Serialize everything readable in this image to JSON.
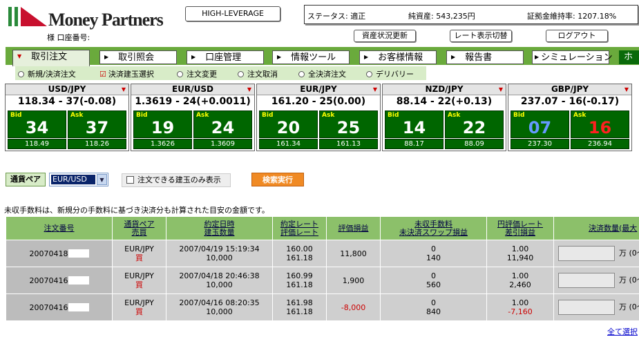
{
  "brand": {
    "name": "Money Partners",
    "account_label": "様 口座番号:"
  },
  "header": {
    "leverage_button": "HIGH-LEVERAGE",
    "status": "ステータス: 適正",
    "net_assets": "純資産: 543,235円",
    "margin_rate": "証拠金維持率: 1207.18%",
    "asset_update": "資産状況更新",
    "rate_toggle": "レート表示切替",
    "logout": "ログアウト"
  },
  "nav": {
    "tabs": [
      "取引注文",
      "取引照会",
      "口座管理",
      "情報ツール",
      "お客様情報",
      "報告書",
      "シミュレーション",
      "ホ"
    ],
    "active": 0
  },
  "subnav": [
    "新規/決済注文",
    "決済建玉選択",
    "注文変更",
    "注文取消",
    "全決済注文",
    "デリバリー"
  ],
  "rates": [
    {
      "pair": "USD/JPY",
      "line": "118.34 - 37(-0.08)",
      "bid_label": "Bid",
      "bid": "34",
      "ask_label": "Ask",
      "ask": "37",
      "low": "118.49",
      "high": "118.26"
    },
    {
      "pair": "EUR/USD",
      "line": "1.3619 - 24(+0.0011)",
      "bid_label": "Bid",
      "bid": "19",
      "ask_label": "Ask",
      "ask": "24",
      "low": "1.3626",
      "high": "1.3609"
    },
    {
      "pair": "EUR/JPY",
      "line": "161.20 - 25(0.00)",
      "bid_label": "Bid",
      "bid": "20",
      "ask_label": "Ask",
      "ask": "25",
      "low": "161.34",
      "high": "161.13"
    },
    {
      "pair": "NZD/JPY",
      "line": "88.14 - 22(+0.13)",
      "bid_label": "Bid",
      "bid": "14",
      "ask_label": "Ask",
      "ask": "22",
      "low": "88.17",
      "high": "88.09"
    },
    {
      "pair": "GBP/JPY",
      "line": "237.07 - 16(-0.17)",
      "bid_label": "Bid",
      "bid": "07",
      "ask_label": "Ask",
      "ask": "16",
      "low": "237.30",
      "high": "236.94"
    }
  ],
  "colors": {
    "bid_down": "#6699ff",
    "ask_up": "#ff2020",
    "normal": "#ffffff"
  },
  "filter": {
    "pair_label": "通貨ペア",
    "pair_value": "EUR/USD",
    "only_orderable": "注文できる建玉のみ表示",
    "search_button": "検索実行"
  },
  "note": "未収手数料は、新規分の手数料に基づき決済分も計算された目安の金額です。",
  "table": {
    "headers": [
      [
        "注文番号"
      ],
      [
        "通貨ペア",
        "売買"
      ],
      [
        "約定日時",
        "建玉数量"
      ],
      [
        "約定レート",
        "評価レート"
      ],
      [
        "評価損益"
      ],
      [
        "未収手数料",
        "未決済スワップ損益"
      ],
      [
        "円評価レート",
        "差引損益"
      ],
      [
        "決済数量(最大"
      ]
    ],
    "rows": [
      {
        "id": "20070418",
        "pair": "EUR/JPY",
        "side": "買",
        "date": "2007/04/19 15:19:34",
        "qty": "10,000",
        "rate": "160.00",
        "eval_rate": "161.18",
        "pl": "11,800",
        "fee": "0",
        "swap": "140",
        "yen_rate": "1.00",
        "net": "11,940",
        "unit": "万",
        "range": "(0〜"
      },
      {
        "id": "20070416",
        "pair": "EUR/JPY",
        "side": "買",
        "date": "2007/04/18 20:46:38",
        "qty": "10,000",
        "rate": "160.99",
        "eval_rate": "161.18",
        "pl": "1,900",
        "fee": "0",
        "swap": "560",
        "yen_rate": "1.00",
        "net": "2,460",
        "unit": "万",
        "range": "(0〜"
      },
      {
        "id": "20070416",
        "pair": "EUR/JPY",
        "side": "買",
        "date": "2007/04/16 08:20:35",
        "qty": "10,000",
        "rate": "161.98",
        "eval_rate": "161.18",
        "pl": "-8,000",
        "fee": "0",
        "swap": "840",
        "yen_rate": "1.00",
        "net": "-7,160",
        "unit": "万",
        "range": "(0〜"
      }
    ]
  },
  "select_all": "全て選択"
}
